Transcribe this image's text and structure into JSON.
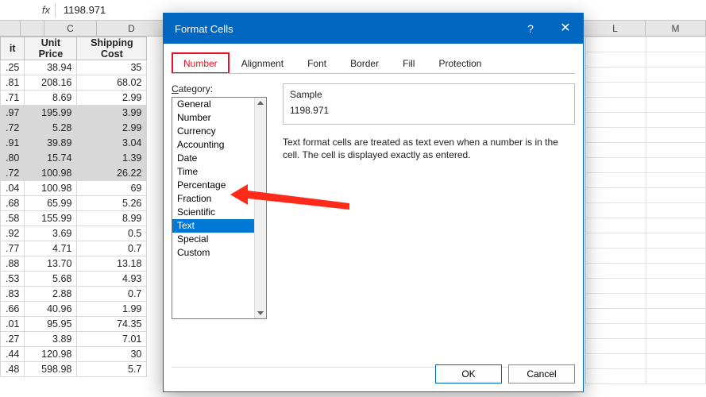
{
  "formula_bar": {
    "fx": "fx",
    "value": "1198.971"
  },
  "columns": {
    "C": "C",
    "D": "D",
    "L": "L",
    "M": "M"
  },
  "headers": {
    "col1": "it",
    "col2": "Unit Price",
    "col3": "Shipping Cost"
  },
  "rows": [
    {
      "b": ".25",
      "c": "38.94",
      "d": "35",
      "sel": false
    },
    {
      "b": ".81",
      "c": "208.16",
      "d": "68.02",
      "sel": false
    },
    {
      "b": ".71",
      "c": "8.69",
      "d": "2.99",
      "sel": false
    },
    {
      "b": ".97",
      "c": "195.99",
      "d": "3.99",
      "sel": true,
      "first": true
    },
    {
      "b": ".72",
      "c": "5.28",
      "d": "2.99",
      "sel": true
    },
    {
      "b": ".91",
      "c": "39.89",
      "d": "3.04",
      "sel": true
    },
    {
      "b": ".80",
      "c": "15.74",
      "d": "1.39",
      "sel": true
    },
    {
      "b": ".72",
      "c": "100.98",
      "d": "26.22",
      "sel": true,
      "last": true
    },
    {
      "b": ".04",
      "c": "100.98",
      "d": "69",
      "sel": false
    },
    {
      "b": ".68",
      "c": "65.99",
      "d": "5.26",
      "sel": false
    },
    {
      "b": ".58",
      "c": "155.99",
      "d": "8.99",
      "sel": false
    },
    {
      "b": ".92",
      "c": "3.69",
      "d": "0.5",
      "sel": false
    },
    {
      "b": ".77",
      "c": "4.71",
      "d": "0.7",
      "sel": false
    },
    {
      "b": ".88",
      "c": "13.70",
      "d": "13.18",
      "sel": false
    },
    {
      "b": ".53",
      "c": "5.68",
      "d": "4.93",
      "sel": false
    },
    {
      "b": ".83",
      "c": "2.88",
      "d": "0.7",
      "sel": false
    },
    {
      "b": ".66",
      "c": "40.96",
      "d": "1.99",
      "sel": false
    },
    {
      "b": ".01",
      "c": "95.95",
      "d": "74.35",
      "sel": false
    },
    {
      "b": ".27",
      "c": "3.89",
      "d": "7.01",
      "sel": false
    },
    {
      "b": ".44",
      "c": "120.98",
      "d": "30",
      "sel": false
    },
    {
      "b": ".48",
      "c": "598.98",
      "d": "5.7",
      "sel": false
    }
  ],
  "dialog": {
    "title": "Format Cells",
    "help": "?",
    "close": "✕",
    "tabs": [
      "Number",
      "Alignment",
      "Font",
      "Border",
      "Fill",
      "Protection"
    ],
    "active_tab": 0,
    "category_label_pre": "C",
    "category_label_post": "ategory:",
    "categories": [
      "General",
      "Number",
      "Currency",
      "Accounting",
      "Date",
      "Time",
      "Percentage",
      "Fraction",
      "Scientific",
      "Text",
      "Special",
      "Custom"
    ],
    "selected_category": 9,
    "sample_label": "Sample",
    "sample_value": "1198.971",
    "description": "Text format cells are treated as text even when a number is in the cell. The cell is displayed exactly as entered.",
    "ok": "OK",
    "cancel": "Cancel"
  }
}
